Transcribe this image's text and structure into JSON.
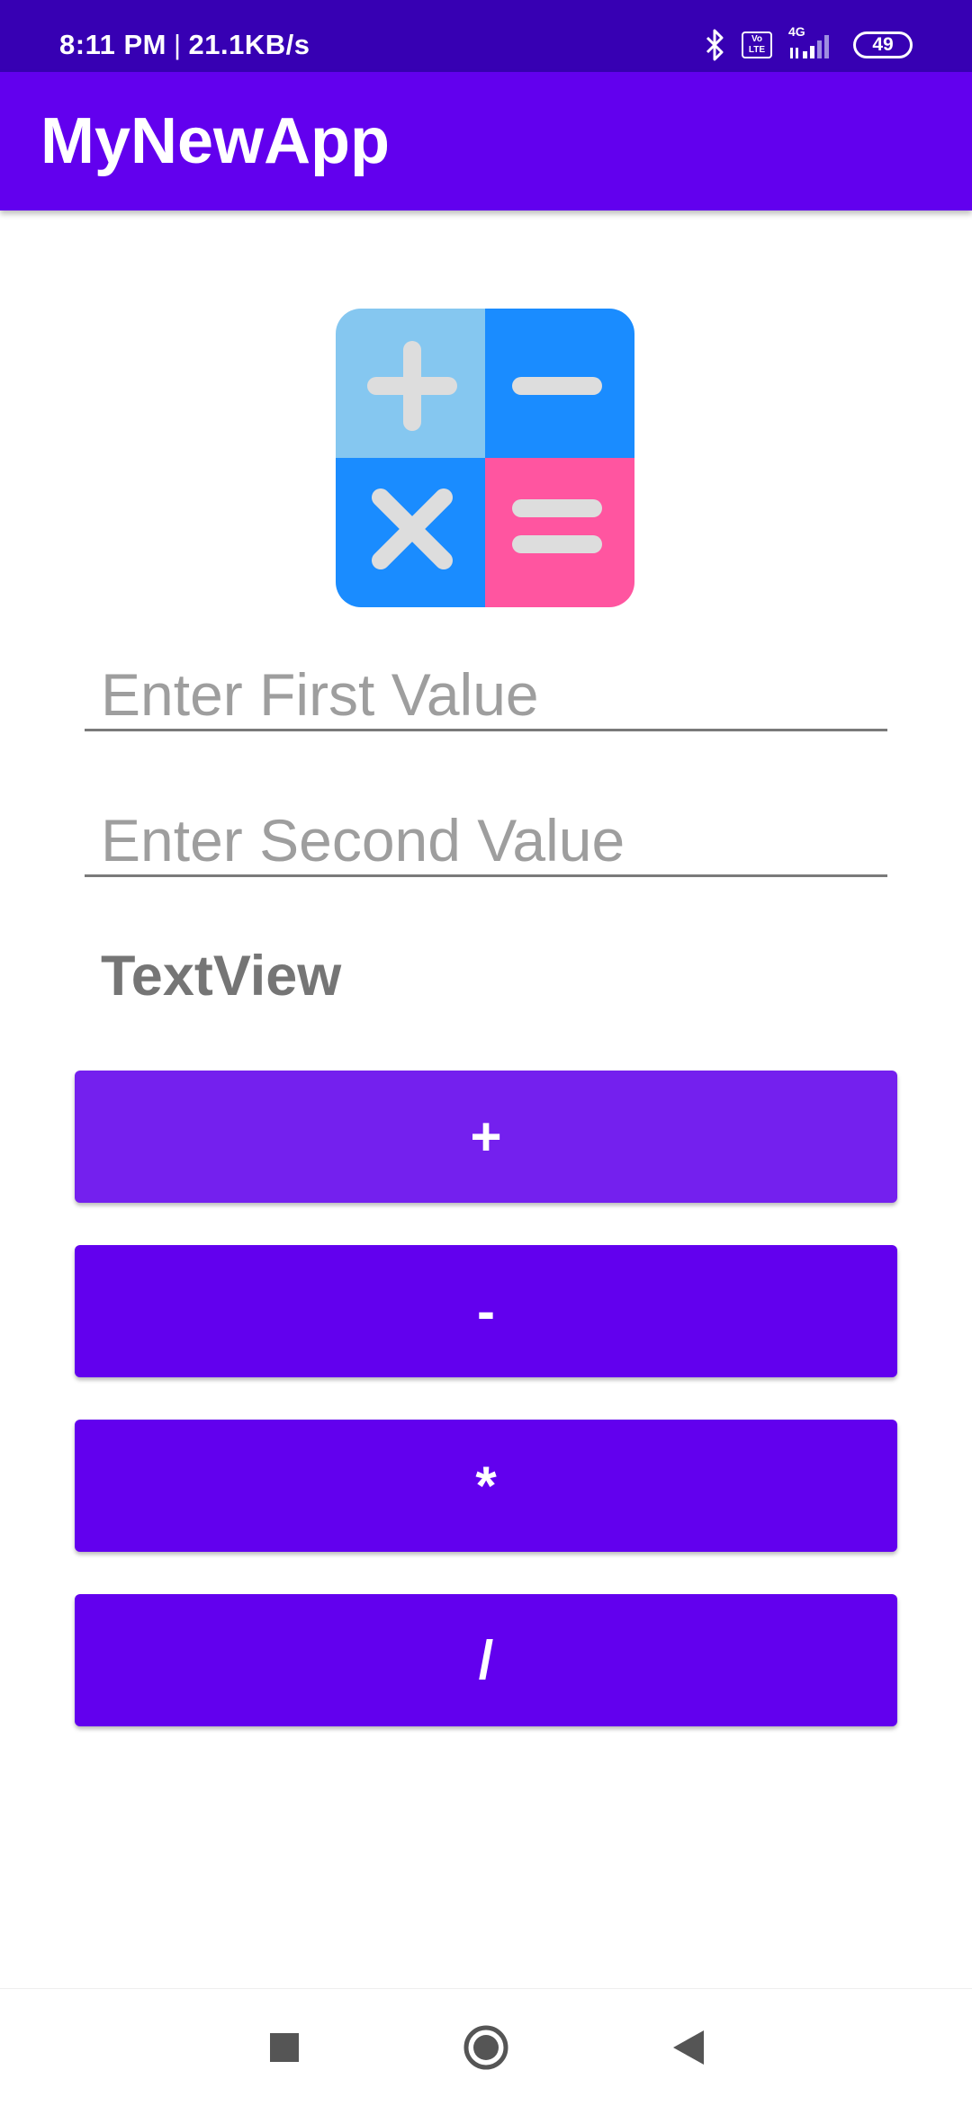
{
  "status_bar": {
    "time": "8:11 PM",
    "separator": "|",
    "speed": "21.1KB/s",
    "network_type": "4G",
    "volte_label": "Vo LTE",
    "battery": "49"
  },
  "app_bar": {
    "title": "MyNewApp"
  },
  "form": {
    "first_placeholder": "Enter First Value",
    "second_placeholder": "Enter Second Value",
    "result_text": "TextView"
  },
  "buttons": {
    "add": "+",
    "subtract": "-",
    "multiply": "*",
    "divide": "/"
  },
  "colors": {
    "status_bar": "#3700B3",
    "app_bar": "#6200EE",
    "button": "#6200EE",
    "button_pressed": "#7420EE",
    "logo_light_blue": "#85C7F0",
    "logo_blue": "#1A8CFF",
    "logo_pink": "#FF55A0",
    "logo_symbol": "#DDDDDD"
  },
  "icons": {
    "logo": "calculator-icon",
    "nav_recents": "square-icon",
    "nav_home": "circle-icon",
    "nav_back": "triangle-back-icon"
  }
}
